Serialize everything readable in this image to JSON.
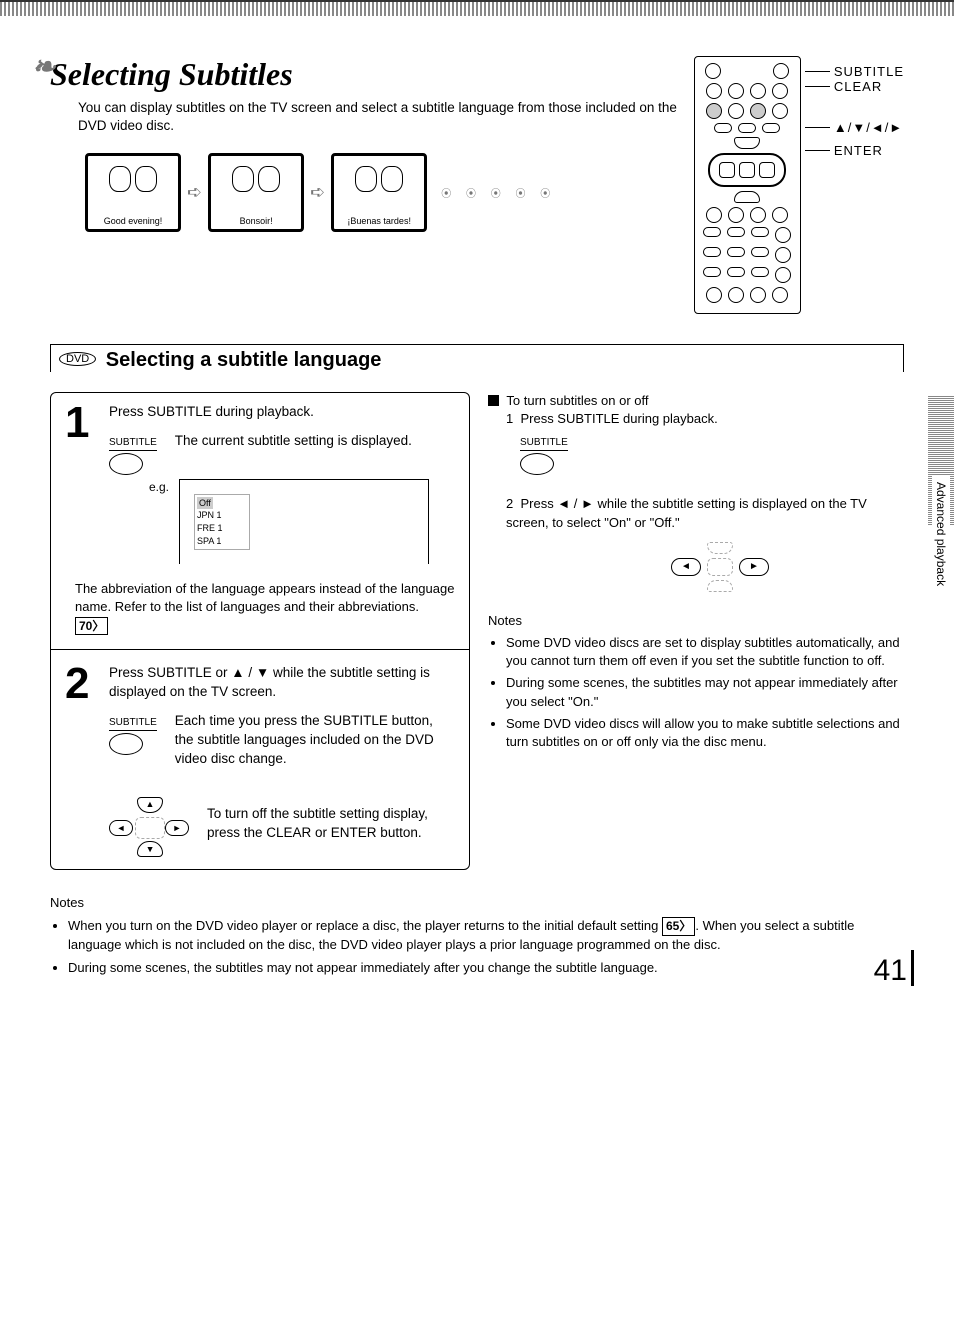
{
  "title": "Selecting Subtitles",
  "intro": "You can display subtitles on the TV screen and select a subtitle language from those included on the DVD video disc.",
  "screens": [
    "Good evening!",
    "Bonsoir!",
    "¡Buenas tardes!"
  ],
  "remote_labels": {
    "subtitle": "SUBTITLE",
    "clear": "CLEAR",
    "arrows": "▲/▼/◄/►",
    "enter": "ENTER"
  },
  "section_badge": "DVD",
  "section_title": "Selecting a subtitle language",
  "step1": {
    "instruction": "Press SUBTITLE during playback.",
    "btn_label": "SUBTITLE",
    "desc": "The current subtitle setting is displayed.",
    "eg_label": "e.g.",
    "menu": {
      "sel": "Off",
      "items": [
        "JPN 1",
        "FRE 1",
        "SPA 1"
      ]
    },
    "abbr_note_1": "The abbreviation of the language appears instead of the language name. Refer to the list of languages and their abbreviations.",
    "abbr_ref": "70"
  },
  "step2": {
    "instruction": "Press SUBTITLE or ▲ / ▼ while the subtitle setting is displayed on the TV screen.",
    "btn_label": "SUBTITLE",
    "desc": "Each time you press the SUBTITLE button, the subtitle languages included on the DVD video disc change.",
    "clear_note": "To turn off the subtitle setting display, press the CLEAR or ENTER button."
  },
  "right": {
    "toggle_head": "To turn subtitles on or off",
    "t1": "Press SUBTITLE during playback.",
    "t1_label": "SUBTITLE",
    "t2": "Press ◄ / ► while the subtitle setting is displayed on the TV screen, to select \"On\" or \"Off.\"",
    "notes_head": "Notes",
    "notes": [
      "Some DVD video discs are set to display subtitles automatically, and you cannot turn them off even if you set the subtitle function to off.",
      "During some scenes, the subtitles may not appear immediately after you select \"On.\"",
      "Some DVD video discs will allow you to make subtitle selections and turn subtitles on or off only via the disc menu."
    ]
  },
  "side_tab": "Advanced playback",
  "bottom_notes_head": "Notes",
  "bottom_notes": [
    {
      "text_a": "When you turn on the DVD video player or replace a disc, the player returns to the initial default setting ",
      "ref": "65",
      "text_b": ". When you select a subtitle language which is not included on the disc, the DVD video player plays a prior language programmed on the disc."
    },
    {
      "text_a": "During some scenes, the subtitles may not appear immediately after you change the subtitle language.",
      "ref": "",
      "text_b": ""
    }
  ],
  "page_number": "41"
}
